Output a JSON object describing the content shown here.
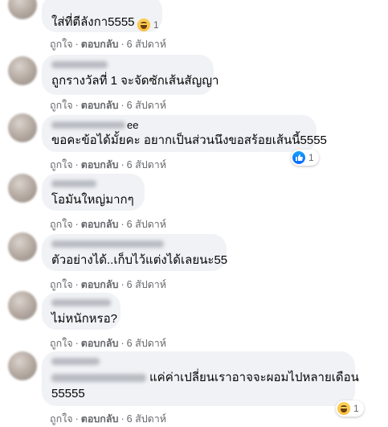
{
  "actions": {
    "like": "ถูกใจ",
    "reply": "ตอบกลับ",
    "dot": "·",
    "time": "6 สัปดาห์"
  },
  "comments": [
    {
      "text": "ใส่ที่ตีลังกา5555",
      "reaction": {
        "icon": "haha-emoji",
        "count": "1"
      }
    },
    {
      "text": "ถูกรางวัลที่ 1 จะจัดซักเส้นสัญญา"
    },
    {
      "name_suffix": "ee",
      "text": "ขอคะข้อได้มั้ยคะ อยากเป็นส่วนนึงขอสร้อยเส้นนี้5555",
      "reaction": {
        "icon": "like-emoji",
        "count": "1"
      }
    },
    {
      "text": "โอมันใหญ่มากๆ"
    },
    {
      "text": "ตัวอย่างได้..เก็บไว้แต่งได้เลยนะ55"
    },
    {
      "text": "ไม่หนักหรอ?"
    },
    {
      "text_line1": "แค่ค่าเปลี่ยนเราอาจจะผอมไปหลายเดือน",
      "text_line2": "55555",
      "reaction": {
        "icon": "haha-emoji",
        "count": "1"
      }
    }
  ]
}
